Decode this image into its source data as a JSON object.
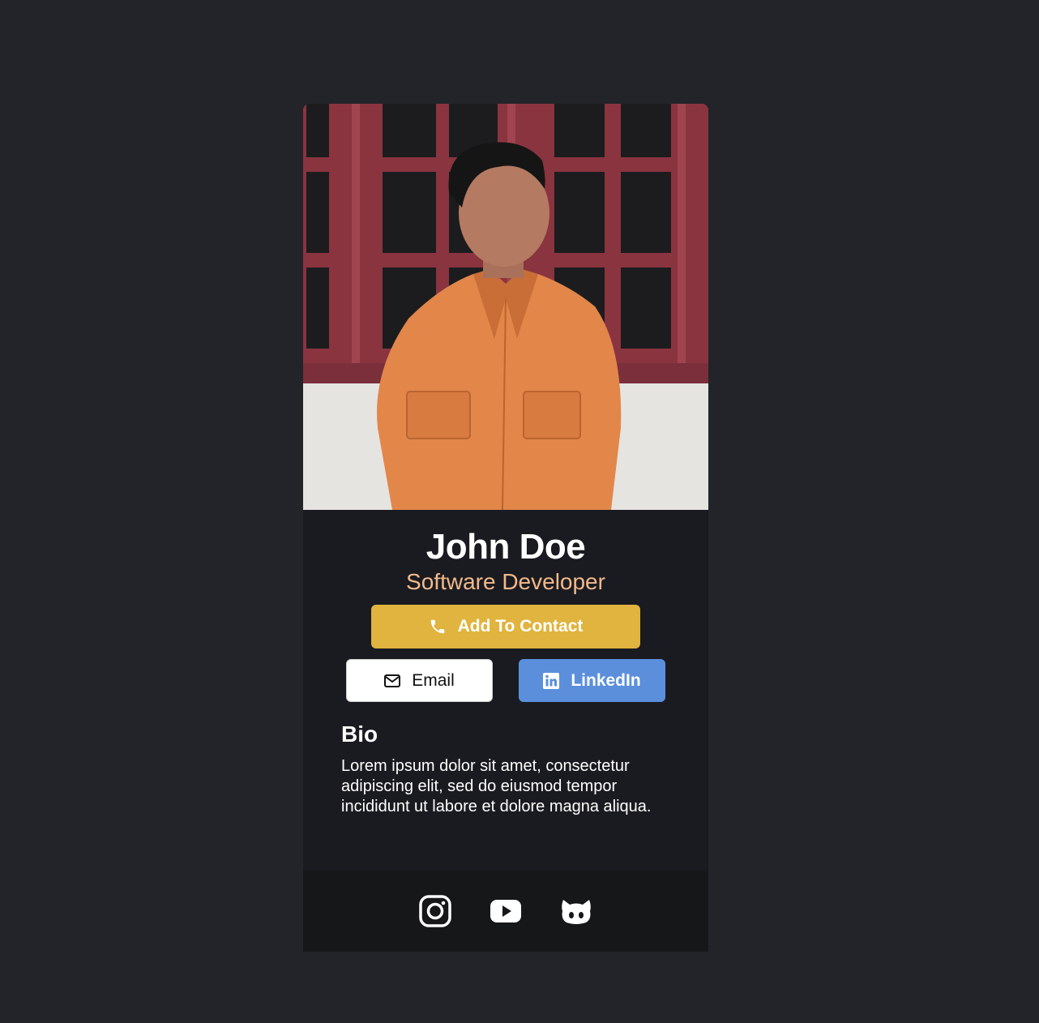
{
  "profile": {
    "name": "John Doe",
    "title": "Software Developer"
  },
  "actions": {
    "add_contact_label": "Add To Contact",
    "email_label": "Email",
    "linkedin_label": "LinkedIn"
  },
  "bio": {
    "heading": "Bio",
    "text": "Lorem ipsum dolor sit amet, consectetur adipiscing elit, sed do eiusmod tempor incididunt ut labore et dolore magna aliqua."
  },
  "social": [
    {
      "icon": "instagram-icon"
    },
    {
      "icon": "youtube-icon"
    },
    {
      "icon": "github-icon"
    }
  ],
  "colors": {
    "page_bg": "#23242a",
    "card_bg": "#1a1b20",
    "footer_bg": "#161719",
    "accent_gold": "#e0b43e",
    "title_peach": "#f2b98b",
    "linkedin_blue": "#5b8fdc"
  }
}
